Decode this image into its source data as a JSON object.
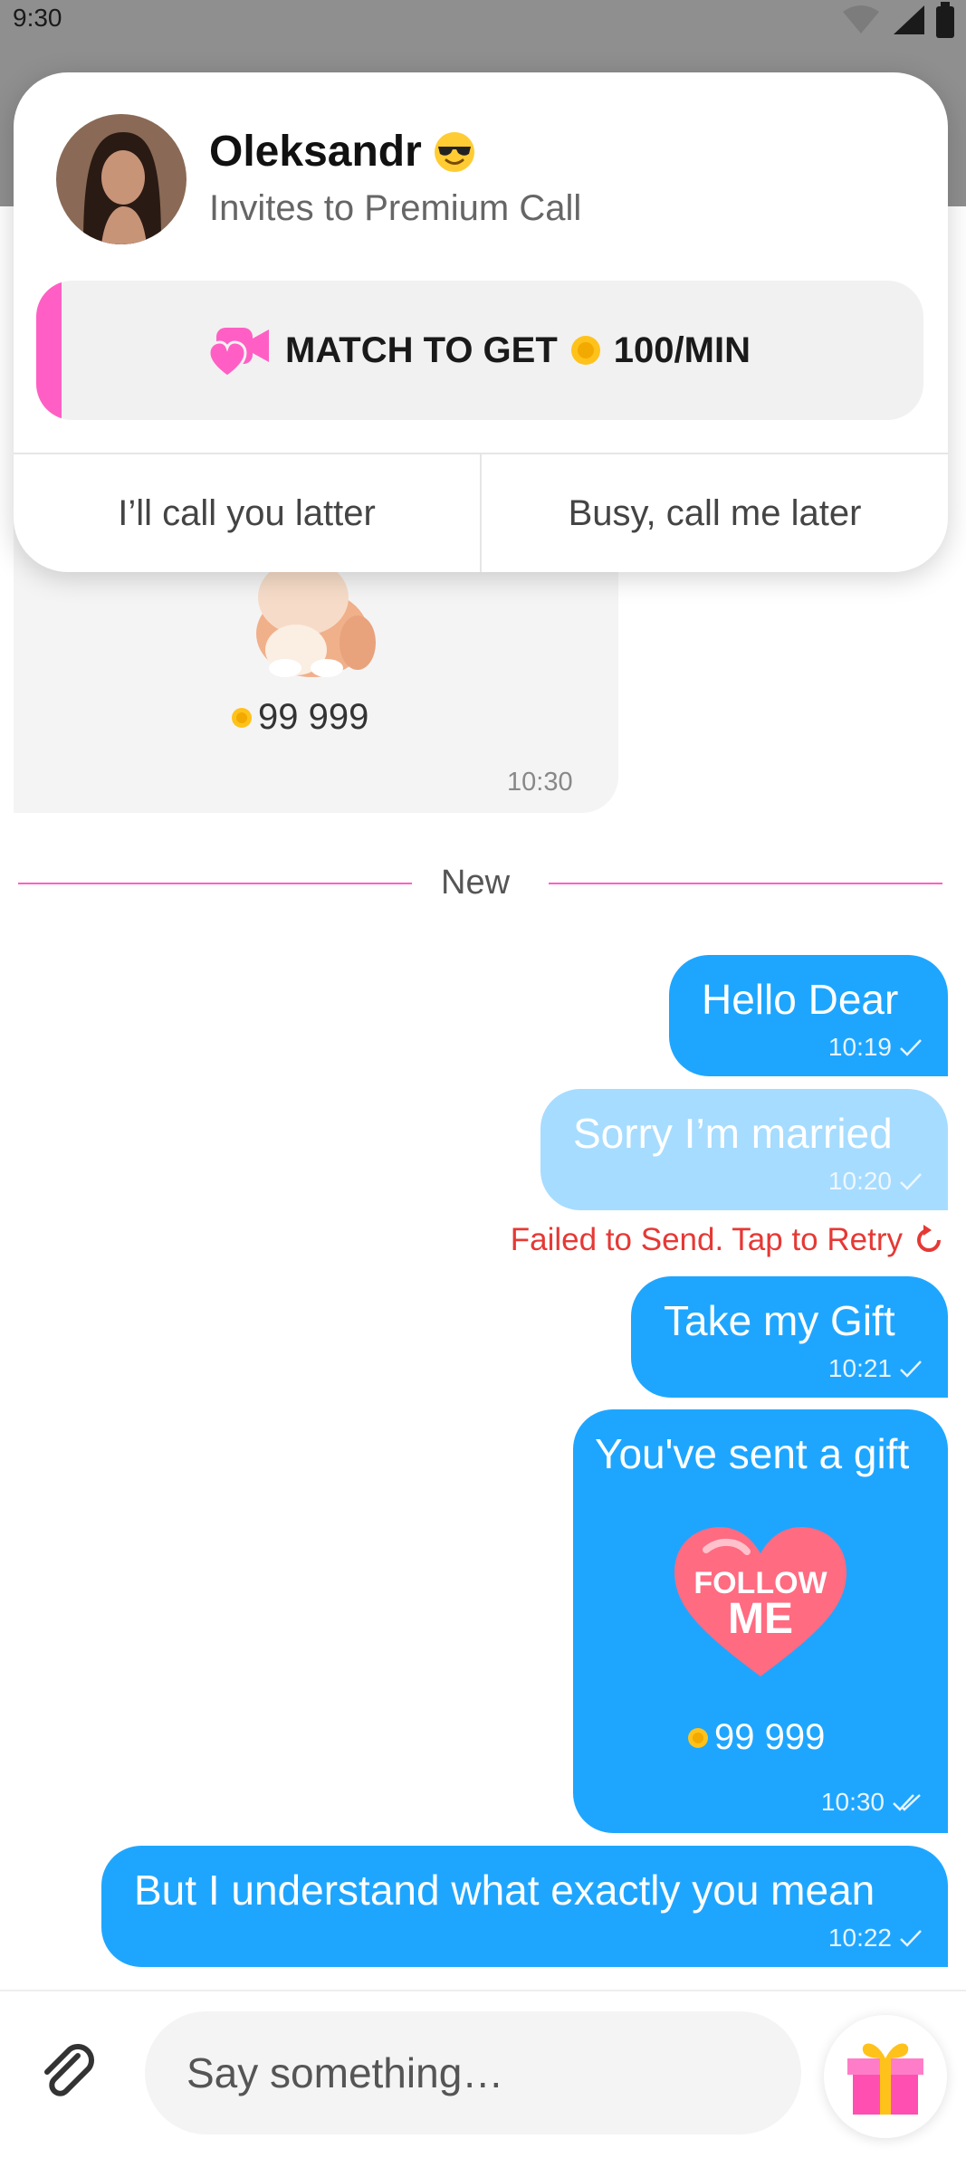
{
  "status_bar": {
    "time": "9:30"
  },
  "notification": {
    "caller_name": "Oleksandr",
    "caller_subtitle": "Invites to Premium Call",
    "match_prefix": "MATCH TO GET",
    "match_rate": "100/MIN",
    "action_left": "I’ll call you latter",
    "action_right": "Busy, call me later"
  },
  "received_gift": {
    "price": "99 999",
    "time": "10:30"
  },
  "divider_label": "New",
  "messages": [
    {
      "text": "Hello Dear",
      "time": "10:19"
    },
    {
      "text": "Sorry I’m married",
      "time": "10:20",
      "failed_notice": "Failed to Send. Tap to Retry"
    },
    {
      "text": "Take my Gift",
      "time": "10:21"
    },
    {
      "text": "You've sent a gift",
      "gift_label_1": "FOLLOW",
      "gift_label_2": "ME",
      "price": "99 999",
      "time": "10:30"
    },
    {
      "text": "But I understand what exactly you mean",
      "time": "10:22"
    }
  ],
  "composer": {
    "placeholder": "Say something…"
  },
  "colors": {
    "accent_pink": "#ff5fc4",
    "sent_blue": "#1ea6ff",
    "failed_blue": "#a6dcff",
    "error_red": "#e53935"
  }
}
